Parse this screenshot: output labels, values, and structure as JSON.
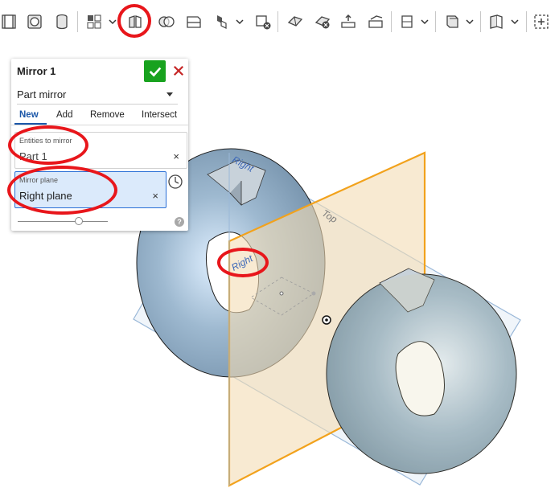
{
  "panel": {
    "title": "Mirror 1",
    "mirror_type": "Part mirror",
    "tabs": [
      "New",
      "Add",
      "Remove",
      "Intersect"
    ],
    "active_tab": "New",
    "entities_label": "Entities to mirror",
    "entities_value": "Part 1",
    "plane_label": "Mirror plane",
    "plane_value": "Right plane",
    "clear_glyph": "×",
    "help_glyph": "?"
  },
  "viewport": {
    "plane_labels": {
      "right_top": "Right",
      "right_center": "Right",
      "top": "Top"
    }
  },
  "colors": {
    "accent": "#1a56a8",
    "confirm": "#18a21e",
    "cancel": "#c62828",
    "annotation": "#e8161b",
    "selected_field": "#dbeafb",
    "torus": "#8aa6bd",
    "mirror_plane_fill": "#f3dcb4",
    "mirror_plane_edge": "#f2a21c"
  },
  "toolbar": {
    "icons": [
      "extrude-icon",
      "revolve-icon",
      "loft-icon",
      "pattern-icon",
      "chevron-down-icon",
      "mirror-icon",
      "boolean-icon",
      "split-icon",
      "transform-icon",
      "chevron-down-icon",
      "delete-part-icon",
      "modify-face-icon",
      "delete-face-icon",
      "move-face-icon",
      "replace-face-icon",
      "plane-icon",
      "chevron-down-icon",
      "sheet-metal-icon",
      "chevron-down-icon",
      "frame-icon",
      "chevron-down-icon",
      "add-custom-feature-icon"
    ]
  }
}
